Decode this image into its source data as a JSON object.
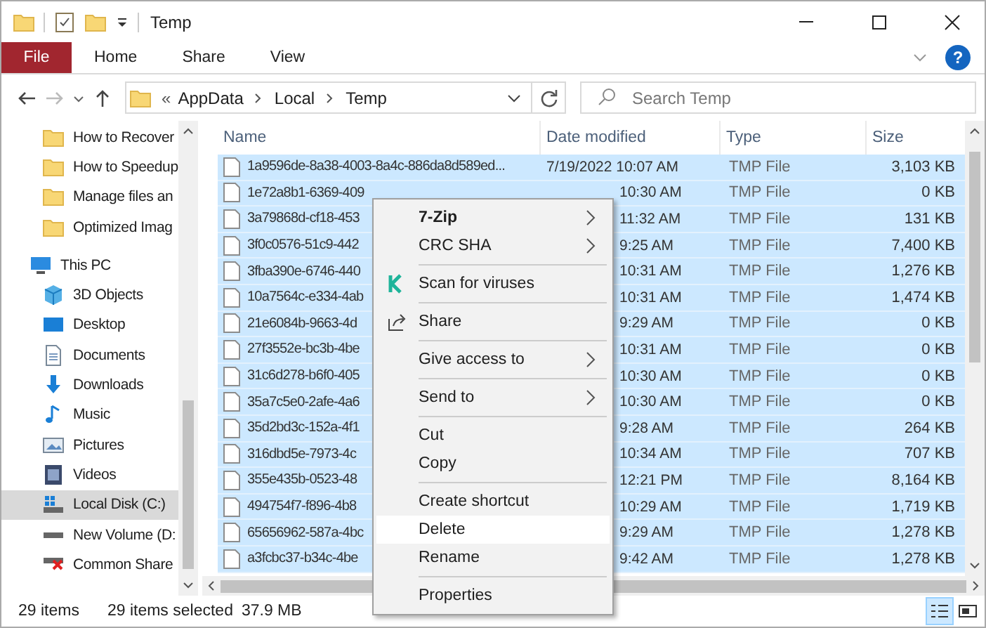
{
  "window": {
    "title": "Temp"
  },
  "ribbon": {
    "tabs": [
      {
        "label": "File",
        "kind": "file",
        "selected": false
      },
      {
        "label": "Home",
        "kind": "tab",
        "selected": false
      },
      {
        "label": "Share",
        "kind": "tab",
        "selected": false
      },
      {
        "label": "View",
        "kind": "tab",
        "selected": false
      }
    ],
    "help": "?"
  },
  "address": {
    "overflow": "«",
    "crumbs": [
      "AppData",
      "Local",
      "Temp"
    ]
  },
  "search": {
    "placeholder": "Search Temp"
  },
  "sidebar": {
    "items": [
      {
        "label": "How to Recover",
        "kind": "folder",
        "selected": false
      },
      {
        "label": "How to Speedup",
        "kind": "folder",
        "selected": false
      },
      {
        "label": "Manage files an",
        "kind": "folder",
        "selected": false
      },
      {
        "label": "Optimized Imag",
        "kind": "folder",
        "selected": false
      },
      {
        "label": "This PC",
        "kind": "pc",
        "selected": false,
        "children": [
          {
            "label": "3D Objects",
            "kind": "objects",
            "selected": false
          },
          {
            "label": "Desktop",
            "kind": "desktop",
            "selected": false
          },
          {
            "label": "Documents",
            "kind": "documents",
            "selected": false
          },
          {
            "label": "Downloads",
            "kind": "downloads",
            "selected": false
          },
          {
            "label": "Music",
            "kind": "music",
            "selected": false
          },
          {
            "label": "Pictures",
            "kind": "pictures",
            "selected": false
          },
          {
            "label": "Videos",
            "kind": "videos",
            "selected": false
          },
          {
            "label": "Local Disk (C:)",
            "kind": "system-drive",
            "selected": true
          },
          {
            "label": "New Volume (D:",
            "kind": "drive",
            "selected": false
          },
          {
            "label": "Common Share",
            "kind": "network-drive",
            "selected": false
          }
        ]
      }
    ]
  },
  "table": {
    "columns": [
      "Name",
      "Date modified",
      "Type",
      "Size"
    ],
    "rows": [
      {
        "name": "1a9596de-8a38-4003-8a4c-886da8d589ed...",
        "date": "7/19/2022 10:07 AM",
        "type": "TMP File",
        "size": "3,103 KB",
        "selected": true
      },
      {
        "name": "1e72a8b1-6369-409",
        "date": "10:30 AM",
        "type": "TMP File",
        "size": "0 KB",
        "selected": true
      },
      {
        "name": "3a79868d-cf18-453",
        "date": "11:32 AM",
        "type": "TMP File",
        "size": "131 KB",
        "selected": true
      },
      {
        "name": "3f0c0576-51c9-442",
        "date": "9:25 AM",
        "type": "TMP File",
        "size": "7,400 KB",
        "selected": true
      },
      {
        "name": "3fba390e-6746-440",
        "date": "10:31 AM",
        "type": "TMP File",
        "size": "1,276 KB",
        "selected": true
      },
      {
        "name": "10a7564c-e334-4ab",
        "date": "10:31 AM",
        "type": "TMP File",
        "size": "1,474 KB",
        "selected": true
      },
      {
        "name": "21e6084b-9663-4d",
        "date": "9:29 AM",
        "type": "TMP File",
        "size": "0 KB",
        "selected": true
      },
      {
        "name": "27f3552e-bc3b-4be",
        "date": "10:31 AM",
        "type": "TMP File",
        "size": "0 KB",
        "selected": true
      },
      {
        "name": "31c6d278-b6f0-405",
        "date": "10:30 AM",
        "type": "TMP File",
        "size": "0 KB",
        "selected": true
      },
      {
        "name": "35a7c5e0-2afe-4a6",
        "date": "10:30 AM",
        "type": "TMP File",
        "size": "0 KB",
        "selected": true
      },
      {
        "name": "35d2bd3c-152a-4f1",
        "date": "9:28 AM",
        "type": "TMP File",
        "size": "264 KB",
        "selected": true
      },
      {
        "name": "316dbd5e-7973-4c",
        "date": "10:34 AM",
        "type": "TMP File",
        "size": "707 KB",
        "selected": true
      },
      {
        "name": "355e435b-0523-48",
        "date": "12:21 PM",
        "type": "TMP File",
        "size": "8,164 KB",
        "selected": true
      },
      {
        "name": "494754f7-f896-4b8",
        "date": "10:29 AM",
        "type": "TMP File",
        "size": "1,719 KB",
        "selected": true
      },
      {
        "name": "65656962-587a-4bc",
        "date": "9:29 AM",
        "type": "TMP File",
        "size": "1,278 KB",
        "selected": true
      },
      {
        "name": "a3fcbc37-b34c-4be",
        "date": "9:42 AM",
        "type": "TMP File",
        "size": "1,278 KB",
        "selected": true
      }
    ]
  },
  "context_menu": {
    "items": [
      {
        "kind": "entry",
        "label": "7-Zip",
        "bold": true,
        "submenu": true,
        "selected": false
      },
      {
        "kind": "entry",
        "label": "CRC SHA",
        "bold": false,
        "submenu": true,
        "selected": false
      },
      {
        "kind": "separator"
      },
      {
        "kind": "scan-entry",
        "label": "Scan for viruses",
        "bold": false,
        "submenu": false,
        "selected": false
      },
      {
        "kind": "separator"
      },
      {
        "kind": "share-entry",
        "label": "Share",
        "bold": false,
        "submenu": false,
        "selected": false
      },
      {
        "kind": "separator"
      },
      {
        "kind": "entry",
        "label": "Give access to",
        "bold": false,
        "submenu": true,
        "selected": false
      },
      {
        "kind": "separator"
      },
      {
        "kind": "entry",
        "label": "Send to",
        "bold": false,
        "submenu": true,
        "selected": false
      },
      {
        "kind": "separator"
      },
      {
        "kind": "entry",
        "label": "Cut",
        "bold": false,
        "submenu": false,
        "selected": false
      },
      {
        "kind": "entry",
        "label": "Copy",
        "bold": false,
        "submenu": false,
        "selected": false
      },
      {
        "kind": "separator"
      },
      {
        "kind": "entry",
        "label": "Create shortcut",
        "bold": false,
        "submenu": false,
        "selected": false
      },
      {
        "kind": "entry",
        "label": "Delete",
        "bold": false,
        "submenu": false,
        "selected": true
      },
      {
        "kind": "entry",
        "label": "Rename",
        "bold": false,
        "submenu": false,
        "selected": false
      },
      {
        "kind": "separator"
      },
      {
        "kind": "entry",
        "label": "Properties",
        "bold": false,
        "submenu": false,
        "selected": false
      }
    ]
  },
  "status_bar": {
    "count": "29 items",
    "selection": "29 items selected",
    "size": "37.9 MB"
  }
}
